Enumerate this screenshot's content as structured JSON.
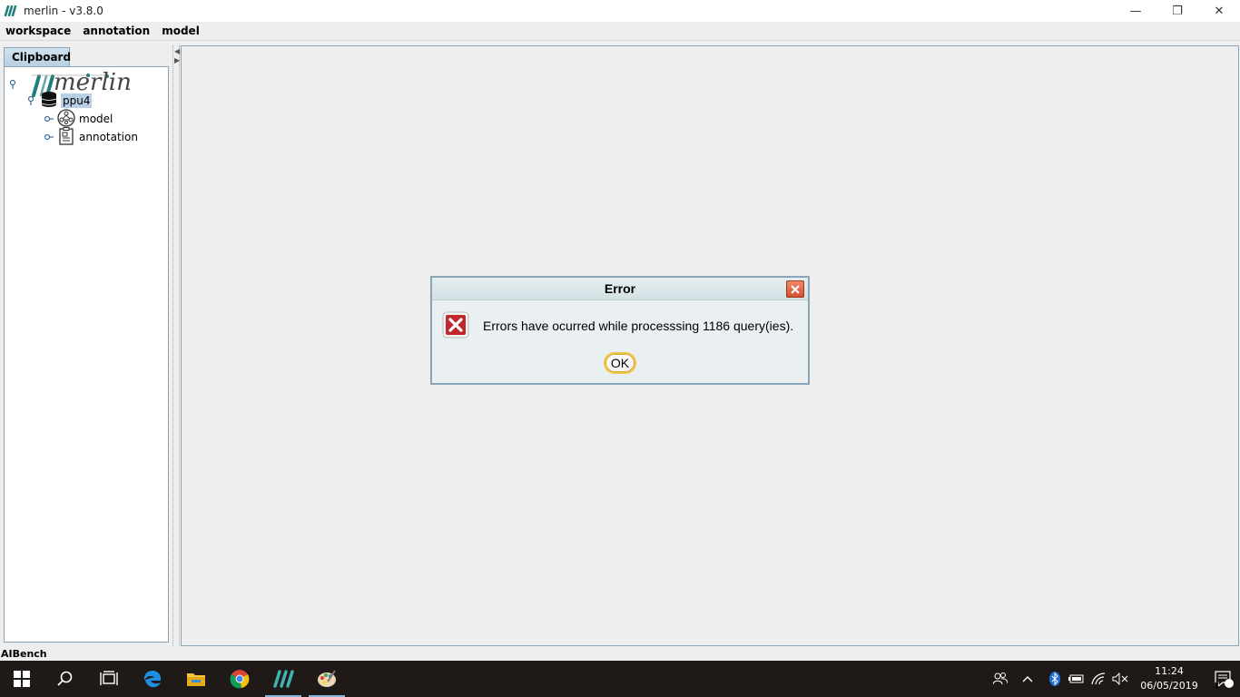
{
  "window": {
    "title": "merlin - v3.8.0",
    "controls": {
      "minimize": "—",
      "restore": "❐",
      "close": "✕"
    }
  },
  "menu": [
    "workspace",
    "annotation",
    "model"
  ],
  "left_panel": {
    "tab_label": "Clipboard",
    "tree": {
      "root_logo": "merlin",
      "workspace": "ppu4",
      "children": [
        "model",
        "annotation"
      ]
    }
  },
  "status": {
    "text": "AIBench"
  },
  "dialog": {
    "title": "Error",
    "message": "Errors have ocurred while processsing 1186 query(ies).",
    "ok_label": "OK"
  },
  "taskbar": {
    "apps": [
      "start-icon",
      "search-icon",
      "task-view-icon",
      "edge-icon",
      "file-explorer-icon",
      "chrome-icon",
      "merlin-icon",
      "paint-icon"
    ],
    "clock_time": "11:24",
    "clock_date": "06/05/2019",
    "notification_count": "1"
  },
  "colors": {
    "accent": "#8aa4b8",
    "error_red": "#c0282d",
    "ok_border": "#f0c44a",
    "taskbar": "#1f1a17"
  }
}
